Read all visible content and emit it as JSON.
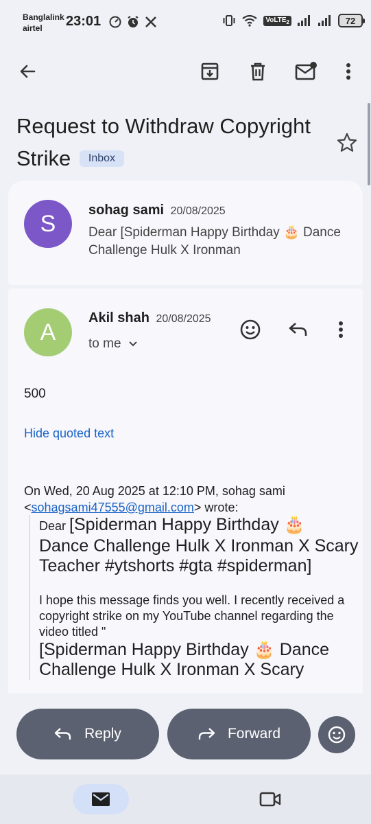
{
  "status_bar": {
    "carrier_1": "Banglalink",
    "carrier_2": "airtel",
    "time": "23:01",
    "volte": "VoLTE",
    "sim_slot": "2",
    "battery": "72"
  },
  "toolbar": {
    "icons": [
      "back-arrow-icon",
      "archive-icon",
      "delete-icon",
      "mark-unread-icon",
      "more-vert-icon"
    ]
  },
  "subject": {
    "title": "Request to Withdraw Copyright Strike",
    "label": "Inbox"
  },
  "messages": [
    {
      "avatar_letter": "S",
      "avatar_color": "#7b57c7",
      "sender": "sohag sami",
      "date": "20/08/2025",
      "snippet": "Dear [Spiderman Happy Birthday 🎂 Dance Challenge Hulk X Ironman"
    },
    {
      "avatar_letter": "A",
      "avatar_color": "#a3cc73",
      "sender": "Akil shah",
      "date": "20/08/2025",
      "recipient": "to me",
      "body": "500",
      "hide_quoted": "Hide quoted text",
      "quote_intro_prefix": "On Wed, 20 Aug 2025 at 12:10 PM, sohag sami <",
      "quote_email": "sohagsami47555@gmail.com",
      "quote_intro_suffix": "> wrote:",
      "quote_dear": "Dear ",
      "quote_title": "[Spiderman Happy Birthday 🎂 Dance Challenge Hulk X Ironman X Scary Teacher #ytshorts #gta #spiderman]",
      "quote_para": "I hope this message finds you well. I recently received a copyright strike on my YouTube channel regarding the video titled \"",
      "quote_para_title": "[Spiderman Happy Birthday 🎂 Dance Challenge Hulk X Ironman X Scary"
    }
  ],
  "actions": {
    "reply": "Reply",
    "forward": "Forward"
  },
  "colors": {
    "accent": "#1a63c7",
    "pill": "#5b6170",
    "label_bg": "#d8e2f7"
  }
}
